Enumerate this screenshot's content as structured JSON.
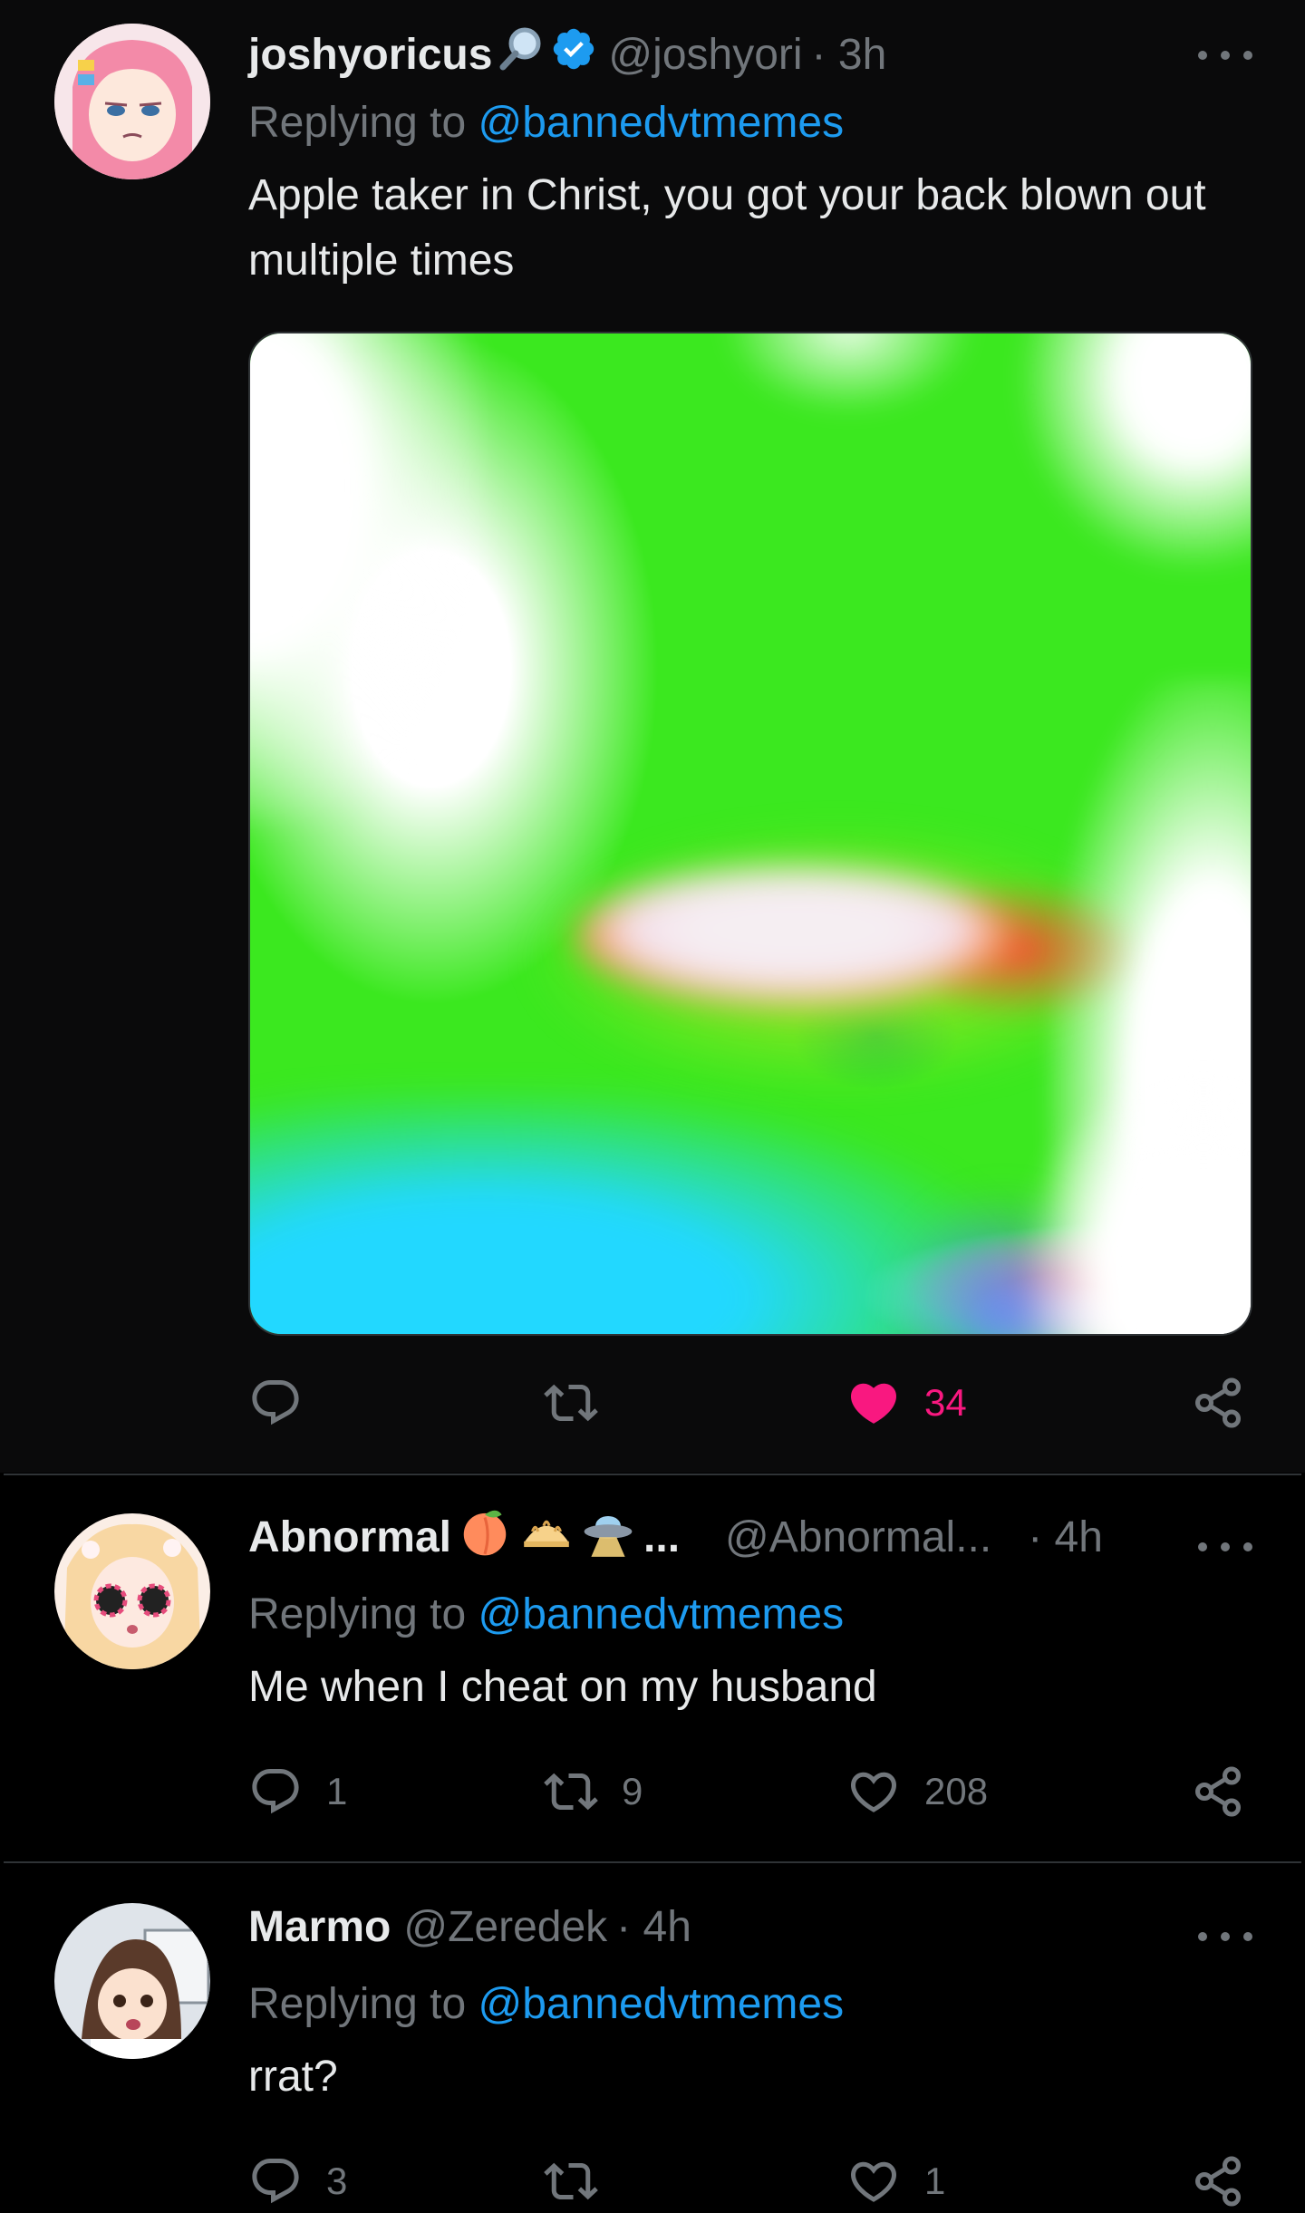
{
  "tweets": [
    {
      "display_name": "joshyoricus",
      "name_emoji": "🔎",
      "verified": true,
      "handle": "@joshyori",
      "time": "· 3h",
      "reply_prefix": "Replying to",
      "reply_to": "@bannedvtmemes",
      "text": "Apple taker in Christ, you got your back blown out multiple times",
      "has_media": true,
      "replies": "",
      "retweets": "",
      "likes": "34",
      "liked": true
    },
    {
      "display_name": "Abnormal",
      "name_emoji": "🍑🥟🛸 ...",
      "verified": false,
      "handle": "@Abnormal...",
      "time": "· 4h",
      "reply_prefix": "Replying to",
      "reply_to": "@bannedvtmemes",
      "text": "Me when I cheat on my husband",
      "has_media": false,
      "replies": "1",
      "retweets": "9",
      "likes": "208",
      "liked": false
    },
    {
      "display_name": "Marmo",
      "name_emoji": "",
      "verified": false,
      "handle": "@Zeredek",
      "time": "· 4h",
      "reply_prefix": "Replying to",
      "reply_to": "@bannedvtmemes",
      "text": "rrat?",
      "has_media": false,
      "replies": "3",
      "retweets": "",
      "likes": "1",
      "liked": false
    }
  ],
  "colors": {
    "background": "#000000",
    "first_tweet_background": "#0a0a0b",
    "text": "#e7e9ea",
    "secondary_text": "#71767b",
    "mention": "#1d9bf0",
    "like_active": "#f91880",
    "verified_badge": "#1d9bf0"
  },
  "icons": {
    "reply": "reply-icon",
    "retweet": "retweet-icon",
    "like": "heart-icon",
    "share": "share-icon",
    "more": "more-options-icon",
    "verified": "verified-badge-icon"
  }
}
